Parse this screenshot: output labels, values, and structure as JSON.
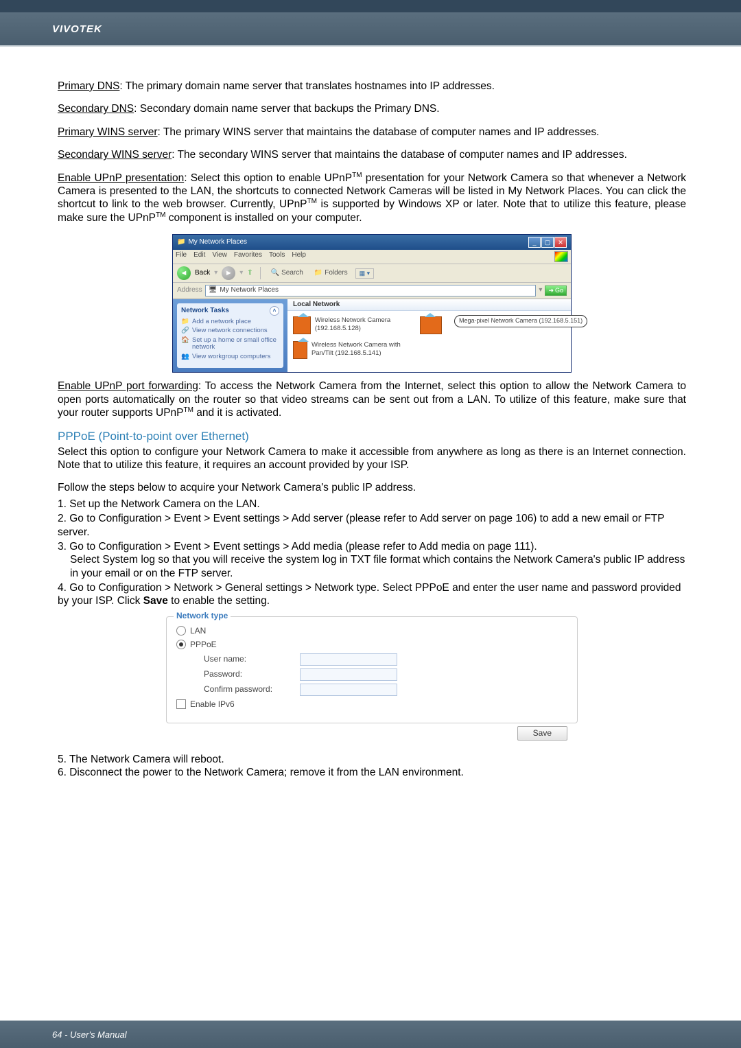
{
  "brand": "VIVOTEK",
  "footer": "64 - User's Manual",
  "defs": {
    "primaryDns": {
      "label": "Primary DNS",
      "text": ": The primary domain name server that translates hostnames into IP addresses."
    },
    "secondaryDns": {
      "label": "Secondary DNS",
      "text": ": Secondary domain name server that backups the Primary DNS."
    },
    "primaryWins": {
      "label": "Primary WINS server",
      "text": ": The primary WINS server that maintains the database of computer names and IP addresses."
    },
    "secondaryWins": {
      "label": "Secondary WINS server",
      "text": ": The secondary WINS server that maintains the database of computer names and IP addresses."
    },
    "upnpPresLabel": "Enable UPnP presentation",
    "upnpPresText1": ": Select this option to enable UPnP",
    "upnpPresTm1": "TM",
    "upnpPresText2": " presentation for your Network Camera so that whenever a Network Camera is presented to the LAN, the shortcuts to connected Network Cameras will be listed in My Network Places. You can click the shortcut to link to the web browser. Currently, UPnP",
    "upnpPresTm2": "TM",
    "upnpPresText3": " is supported by Windows XP or later. Note that to utilize this feature, please make sure the UPnP",
    "upnpPresTm3": "TM",
    "upnpPresText4": " component is installed on your computer.",
    "upnpFwdLabel": "Enable UPnP port forwarding",
    "upnpFwdText1": ": To access the Network Camera from the Internet, select this option to allow the Network Camera to open ports automatically on the router so that video streams can be sent out from a LAN. To utilize of this feature, make sure that your router supports UPnP",
    "upnpFwdTm": "TM",
    "upnpFwdText2": " and it is activated."
  },
  "pppoe": {
    "title": "PPPoE (Point-to-point over Ethernet)",
    "intro": "Select this option to configure your Network Camera to make it accessible from anywhere as long as there is an Internet connection. Note that to utilize this feature, it requires an account provided by your ISP.",
    "follow": "Follow the steps below to acquire your Network Camera's public IP address.",
    "step1": "1. Set up the Network Camera on the LAN.",
    "step2": "2. Go to Configuration > Event > Event settings > Add server (please refer to Add server on page 106) to add a new email or FTP server.",
    "step3": "3. Go to Configuration > Event > Event settings > Add media (please refer to Add media on page 111).",
    "step3b": "Select System log so that you will receive the system log in TXT file format which contains the Network Camera's public IP address in your email or on the FTP server.",
    "step4a": "4. Go to Configuration > Network > General settings > Network type. Select PPPoE and enter the user name and password provided by your ISP. Click ",
    "step4bold": "Save",
    "step4b": " to enable the setting.",
    "step5": "5. The Network Camera will reboot.",
    "step6": "6. Disconnect the power to the Network Camera; remove it from the LAN environment."
  },
  "explorer": {
    "title": "My Network Places",
    "menu": {
      "file": "File",
      "edit": "Edit",
      "view": "View",
      "favorites": "Favorites",
      "tools": "Tools",
      "help": "Help"
    },
    "toolbar": {
      "back": "Back",
      "search": "Search",
      "folders": "Folders"
    },
    "address": {
      "label": "Address",
      "value": "My Network Places",
      "go": "Go"
    },
    "sidebar": {
      "title": "Network Tasks",
      "items": [
        "Add a network place",
        "View network connections",
        "Set up a home or small office network",
        "View workgroup computers"
      ]
    },
    "section": "Local Network",
    "cams": [
      {
        "name": "Wireless Network Camera (192.168.5.128)"
      },
      {
        "name": "Wireless Network Camera with Pan/Tilt (192.168.5.141)"
      }
    ],
    "callout": "Mega-pixel Network Camera (192.168.5.151)"
  },
  "panel": {
    "legend": "Network type",
    "lan": "LAN",
    "pppoe": "PPPoE",
    "user": "User name:",
    "pass": "Password:",
    "confirm": "Confirm password:",
    "ipv6": "Enable IPv6",
    "save": "Save"
  }
}
